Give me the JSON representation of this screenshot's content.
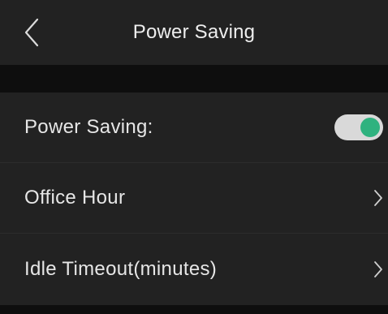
{
  "header": {
    "title": "Power Saving",
    "back_icon": "chevron-left-icon"
  },
  "settings": {
    "power_saving": {
      "label": "Power Saving:",
      "enabled": true,
      "toggle_color": "#2fb27f"
    },
    "office_hour": {
      "label": "Office Hour",
      "icon": "chevron-right-icon"
    },
    "idle_timeout": {
      "label": "Idle Timeout(minutes)",
      "icon": "chevron-right-icon"
    }
  }
}
